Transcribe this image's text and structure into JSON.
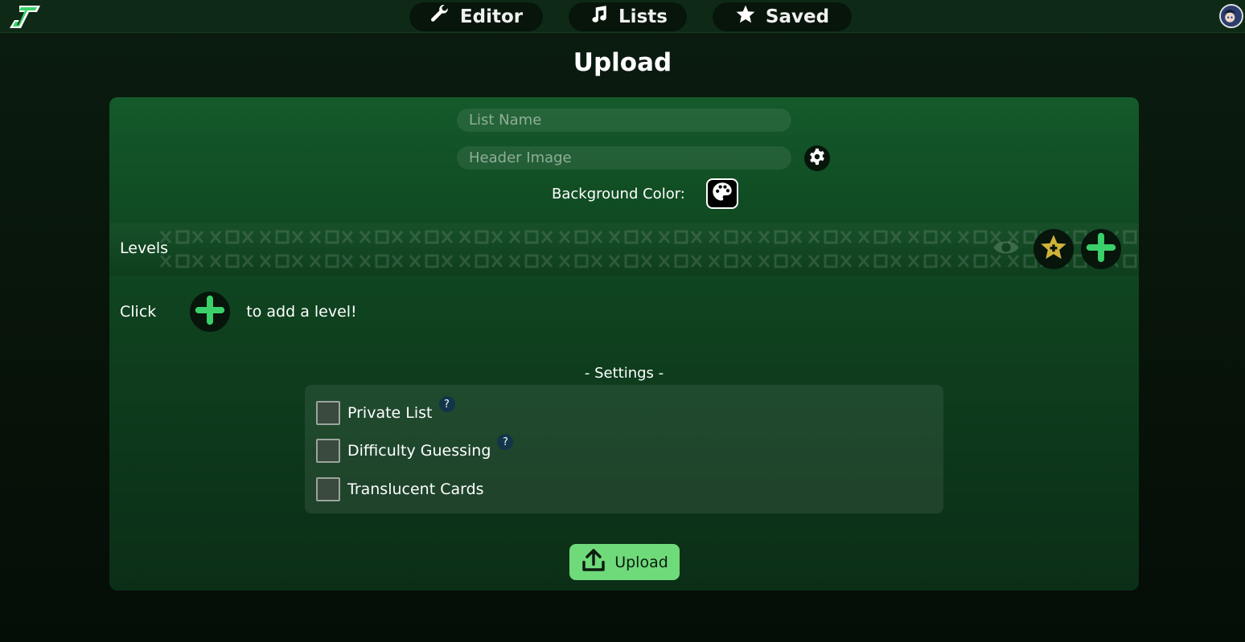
{
  "nav": {
    "editor": "Editor",
    "lists": "Lists",
    "saved": "Saved"
  },
  "page": {
    "title": "Upload"
  },
  "form": {
    "list_name_placeholder": "List Name",
    "header_image_placeholder": "Header Image",
    "background_color_label": "Background Color:"
  },
  "levels": {
    "label": "Levels",
    "hint_before": "Click",
    "hint_after": "to add a level!"
  },
  "settings": {
    "title": "- Settings -",
    "items": [
      {
        "label": "Private List",
        "checked": false,
        "help": "?"
      },
      {
        "label": "Difficulty Guessing",
        "checked": false,
        "help": "?"
      },
      {
        "label": "Translucent Cards",
        "checked": false
      }
    ]
  },
  "upload_button": {
    "label": "Upload"
  },
  "colors": {
    "accent_green": "#6fda7a",
    "plus_green": "#3ad06a",
    "star_gold": "#d1b33a",
    "card_top": "#145a2a",
    "topbar": "#0e2a17"
  },
  "icons": {
    "logo": "gd-lists-logo-icon",
    "editor": "wrench-icon",
    "lists": "music-note-icon",
    "saved": "star-icon",
    "settings": "gear-icon",
    "palette": "palette-icon",
    "preview": "eye-icon",
    "favorite": "star-plus-icon",
    "add": "plus-icon",
    "upload": "upload-icon"
  }
}
